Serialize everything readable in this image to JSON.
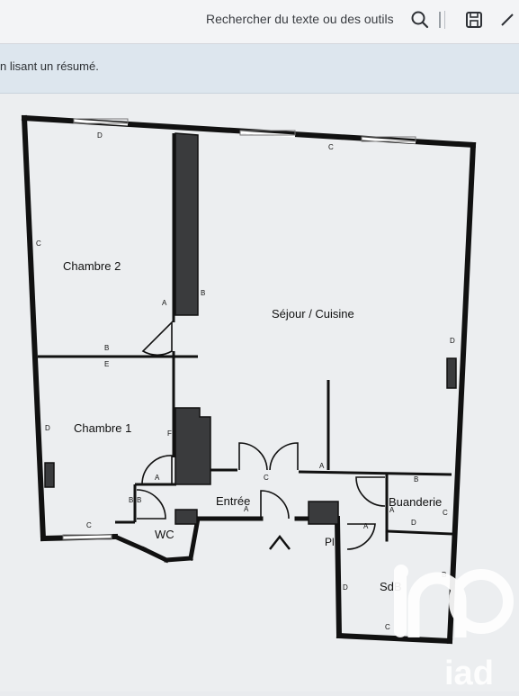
{
  "toolbar": {
    "search_label": "Rechercher du texte ou des outils",
    "search_icon": "search-icon",
    "save_icon": "save-icon"
  },
  "banner": {
    "text": "n lisant un résumé."
  },
  "floorplan": {
    "rooms": {
      "chambre2": "Chambre 2",
      "chambre1": "Chambre 1",
      "sejour": "Séjour / Cuisine",
      "entree": "Entrée",
      "wc": "WC",
      "buanderie": "Buanderie",
      "sdb": "SdB",
      "placard": "Pl"
    },
    "markers": {
      "d_top": "D",
      "c_top": "C",
      "c_left": "C",
      "a_ch2": "A",
      "b_ch2": "B",
      "b_hall": "B",
      "e_hall": "E",
      "d_right": "D",
      "d_ch1": "D",
      "f_ch1": "F",
      "a_ch1": "A",
      "c_bottom": "C",
      "b_wc1": "B",
      "b_wc2": "B",
      "c_door": "C",
      "a_door": "A",
      "a_entree": "A",
      "b_buand": "B",
      "a_buand": "A",
      "c_buand": "C",
      "d_buand": "D",
      "a_sdb": "A",
      "d_sdb": "D",
      "b_sdb": "B",
      "c_sdb": "C"
    },
    "entrance_arrow": "^"
  },
  "watermark": {
    "brand": "iad"
  }
}
